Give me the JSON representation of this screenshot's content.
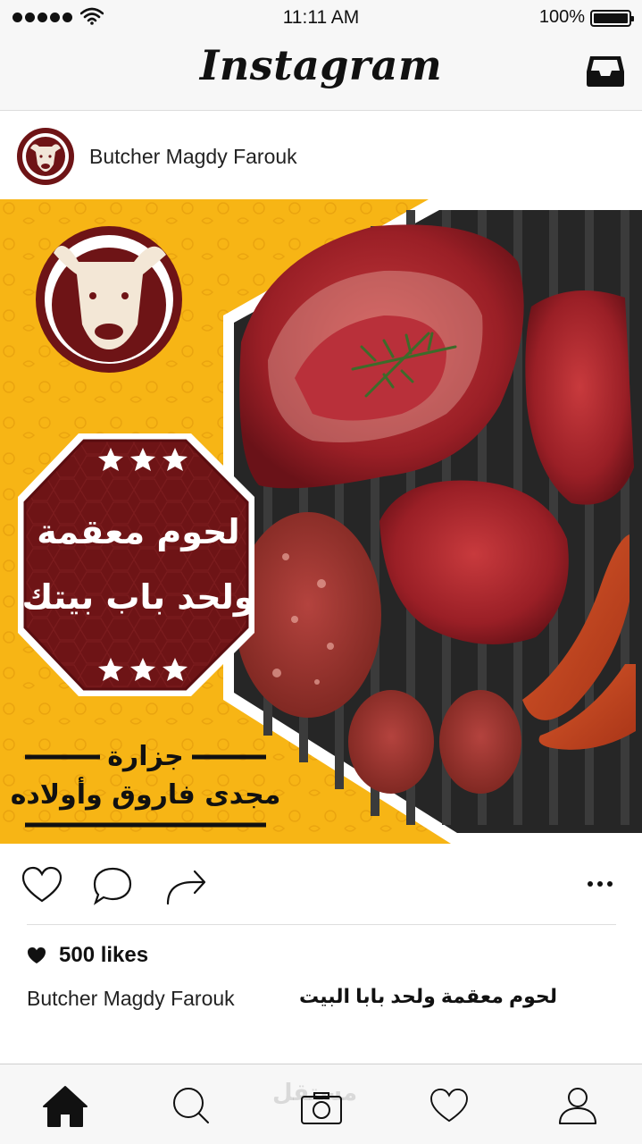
{
  "status_bar": {
    "time": "11:11 AM",
    "battery": "100%"
  },
  "header": {
    "title": "Instagram",
    "inbox_icon": "inbox-icon"
  },
  "post": {
    "username": "Butcher Magdy Farouk",
    "image": {
      "headline_line1": "لحوم معقمة",
      "headline_line2": "ولحد باب بيتك",
      "brand_line1": "جزارة",
      "brand_line2": "مجدى فاروق وأولاده",
      "colors": {
        "yellow": "#f7b515",
        "maroon": "#6e1416",
        "grill": "#2a2a2a",
        "meat": "#a8232a"
      }
    },
    "likes": "500 likes",
    "caption_user": "Butcher Magdy Farouk",
    "caption_text": "لحوم معقمة ولحد بابا البيت"
  },
  "tabbar": {
    "watermark": "مستقل"
  }
}
